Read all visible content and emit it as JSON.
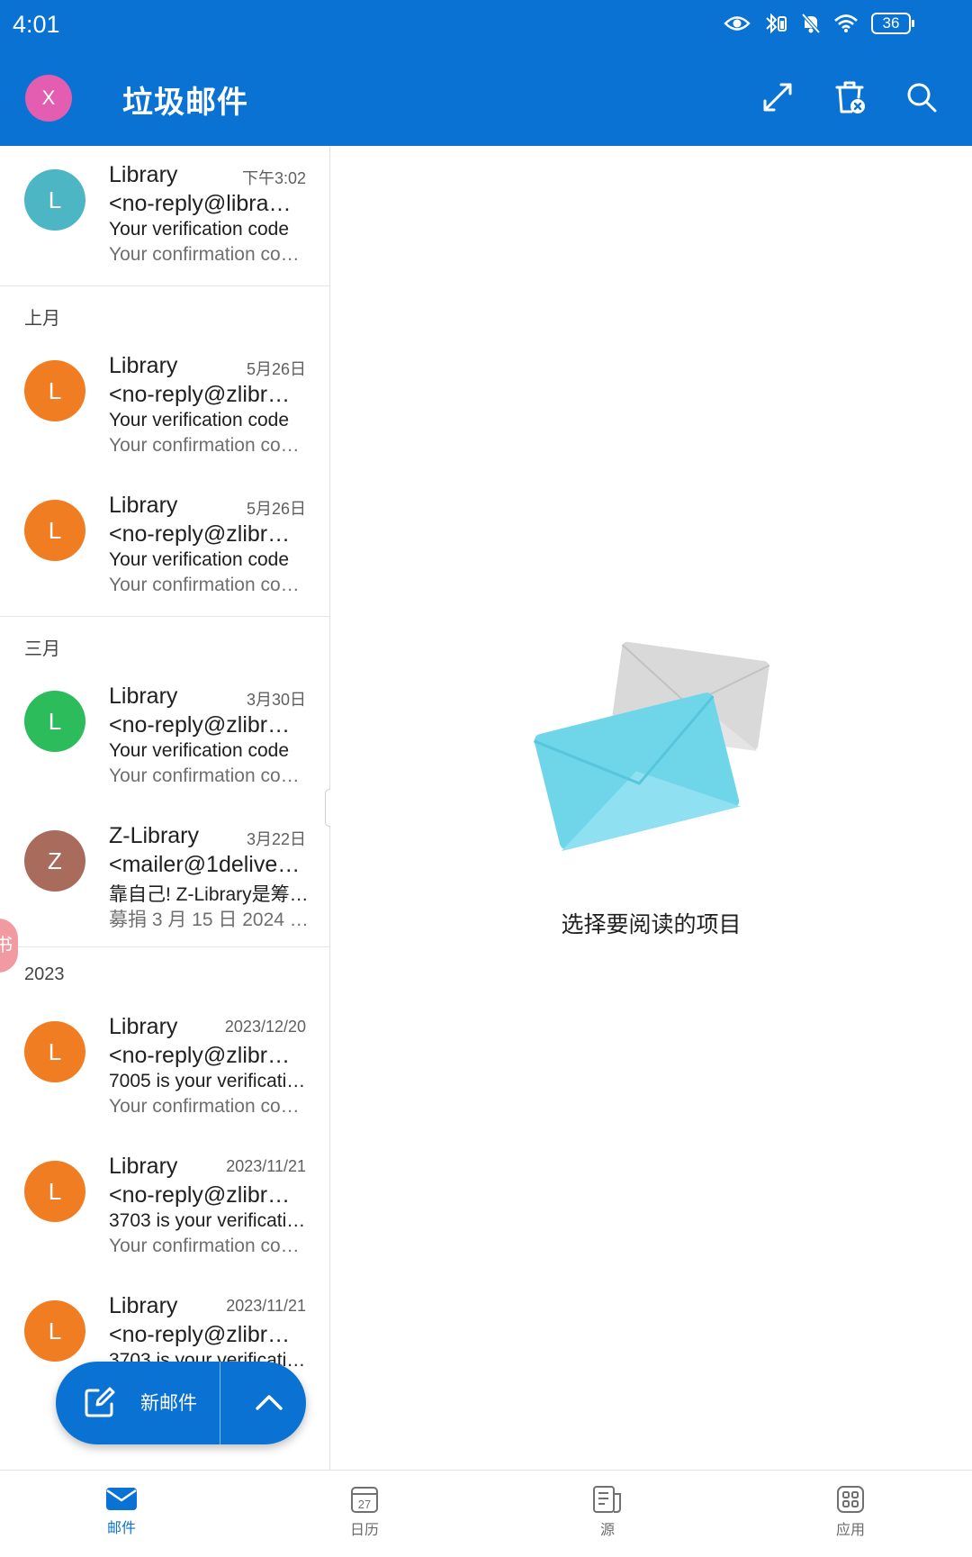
{
  "status_bar": {
    "time": "4:01",
    "battery": "36"
  },
  "header": {
    "account_initial": "X",
    "title": "垃圾邮件"
  },
  "sections": {
    "last_month": "上月",
    "march": "三月",
    "year_2023": "2023"
  },
  "mails": [
    {
      "initial": "L",
      "color": "#4db6c4",
      "sender": "Library",
      "date": "下午3:02",
      "address": "<no-reply@libra…",
      "subject": "Your verification code",
      "preview": "Your confirmation co…"
    },
    {
      "initial": "L",
      "color": "#f07d22",
      "sender": "Library",
      "date": "5月26日",
      "address": "<no-reply@zlibr…",
      "subject": "Your verification code",
      "preview": "Your confirmation co…"
    },
    {
      "initial": "L",
      "color": "#f07d22",
      "sender": "Library",
      "date": "5月26日",
      "address": "<no-reply@zlibr…",
      "subject": "Your verification code",
      "preview": "Your confirmation co…"
    },
    {
      "initial": "L",
      "color": "#2dbc5c",
      "sender": "Library",
      "date": "3月30日",
      "address": "<no-reply@zlibr…",
      "subject": "Your verification code",
      "preview": "Your confirmation co…"
    },
    {
      "initial": "Z",
      "color": "#a86b5c",
      "sender": "Z-Library",
      "date": "3月22日",
      "address": "<mailer@1delive…",
      "subject": "靠自己! Z-Library是筹…",
      "preview": "募捐 3 月 15 日 2024 …"
    },
    {
      "initial": "L",
      "color": "#f07d22",
      "sender": "Library",
      "date": "2023/12/20",
      "address": "<no-reply@zlibr…",
      "subject": "7005 is your verificati…",
      "preview": "Your confirmation co…"
    },
    {
      "initial": "L",
      "color": "#f07d22",
      "sender": "Library",
      "date": "2023/11/21",
      "address": "<no-reply@zlibr…",
      "subject": "3703 is your verificati…",
      "preview": "Your confirmation co…"
    },
    {
      "initial": "L",
      "color": "#f07d22",
      "sender": "Library",
      "date": "2023/11/21",
      "address": "<no-reply@zlibr…",
      "subject": "3703 is your verificati…",
      "preview": ""
    }
  ],
  "side_tab": {
    "label": "书"
  },
  "fab": {
    "label": "新邮件"
  },
  "reading_pane": {
    "empty_message": "选择要阅读的项目"
  },
  "bottom_nav": {
    "mail": "邮件",
    "calendar": "日历",
    "calendar_day": "27",
    "feed": "源",
    "apps": "应用"
  },
  "colors": {
    "brand": "#0a72d3",
    "avatar_account": "#e35db0"
  }
}
